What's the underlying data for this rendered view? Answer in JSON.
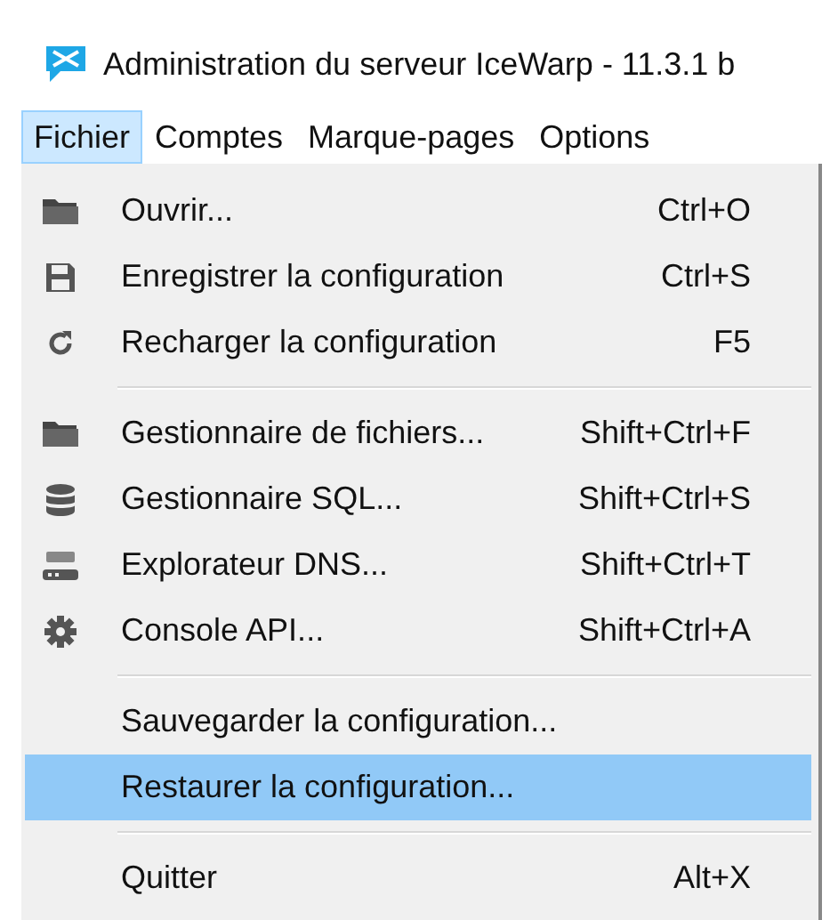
{
  "window": {
    "title": "Administration du serveur IceWarp - 11.3.1 b"
  },
  "menubar": [
    {
      "label": "Fichier",
      "selected": true
    },
    {
      "label": "Comptes",
      "selected": false
    },
    {
      "label": "Marque-pages",
      "selected": false
    },
    {
      "label": "Options",
      "selected": false
    }
  ],
  "menu": [
    {
      "kind": "item",
      "label": "Ouvrir...",
      "shortcut": "Ctrl+O",
      "selected": false
    },
    {
      "kind": "item",
      "label": "Enregistrer la configuration",
      "shortcut": "Ctrl+S",
      "selected": false
    },
    {
      "kind": "item",
      "label": "Recharger la configuration",
      "shortcut": "F5",
      "selected": false
    },
    {
      "kind": "separator"
    },
    {
      "kind": "item",
      "label": "Gestionnaire de fichiers...",
      "shortcut": "Shift+Ctrl+F",
      "selected": false
    },
    {
      "kind": "item",
      "label": "Gestionnaire SQL...",
      "shortcut": "Shift+Ctrl+S",
      "selected": false
    },
    {
      "kind": "item",
      "label": "Explorateur DNS...",
      "shortcut": "Shift+Ctrl+T",
      "selected": false
    },
    {
      "kind": "item",
      "label": "Console API...",
      "shortcut": "Shift+Ctrl+A",
      "selected": false
    },
    {
      "kind": "separator"
    },
    {
      "kind": "item",
      "label": "Sauvegarder la configuration...",
      "selected": false
    },
    {
      "kind": "item",
      "label": "Restaurer la configuration...",
      "selected": true
    },
    {
      "kind": "separator"
    },
    {
      "kind": "item",
      "label": "Quitter",
      "shortcut": "Alt+X",
      "selected": false
    }
  ]
}
